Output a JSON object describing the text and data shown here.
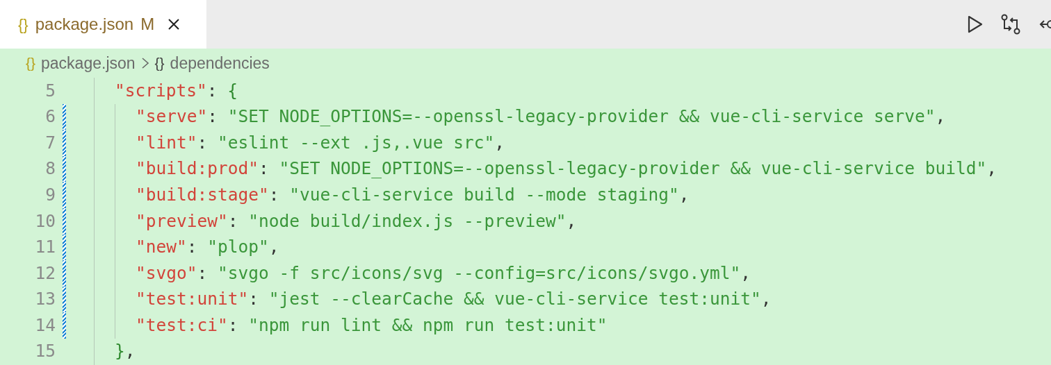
{
  "tab": {
    "icon": "{}",
    "title": "package.json",
    "badge": "M",
    "selected": true
  },
  "breadcrumbs": [
    {
      "icon": "{}",
      "label": "package.json",
      "kind": "file"
    },
    {
      "icon": "{}",
      "label": "dependencies",
      "kind": "symbol"
    }
  ],
  "lines": [
    {
      "number": "5",
      "modified": false,
      "tokens": [
        {
          "kind": "key",
          "text": "\"scripts\""
        },
        {
          "kind": "punct",
          "text": ": "
        },
        {
          "kind": "bracket",
          "text": "{"
        }
      ],
      "children": [
        {
          "number": "6",
          "modified": true,
          "tokens": [
            {
              "kind": "key",
              "text": "\"serve\""
            },
            {
              "kind": "punct",
              "text": ": "
            },
            {
              "kind": "string",
              "text": "\"SET NODE_OPTIONS=--openssl-legacy-provider && vue-cli-service serve\""
            },
            {
              "kind": "punct",
              "text": ","
            }
          ]
        },
        {
          "number": "7",
          "modified": true,
          "tokens": [
            {
              "kind": "key",
              "text": "\"lint\""
            },
            {
              "kind": "punct",
              "text": ": "
            },
            {
              "kind": "string",
              "text": "\"eslint --ext .js,.vue src\""
            },
            {
              "kind": "punct",
              "text": ","
            }
          ]
        },
        {
          "number": "8",
          "modified": true,
          "tokens": [
            {
              "kind": "key",
              "text": "\"build:prod\""
            },
            {
              "kind": "punct",
              "text": ": "
            },
            {
              "kind": "string",
              "text": "\"SET NODE_OPTIONS=--openssl-legacy-provider && vue-cli-service build\""
            },
            {
              "kind": "punct",
              "text": ","
            }
          ]
        },
        {
          "number": "9",
          "modified": true,
          "tokens": [
            {
              "kind": "key",
              "text": "\"build:stage\""
            },
            {
              "kind": "punct",
              "text": ": "
            },
            {
              "kind": "string",
              "text": "\"vue-cli-service build --mode staging\""
            },
            {
              "kind": "punct",
              "text": ","
            }
          ]
        },
        {
          "number": "10",
          "modified": true,
          "tokens": [
            {
              "kind": "key",
              "text": "\"preview\""
            },
            {
              "kind": "punct",
              "text": ": "
            },
            {
              "kind": "string",
              "text": "\"node build/index.js --preview\""
            },
            {
              "kind": "punct",
              "text": ","
            }
          ]
        },
        {
          "number": "11",
          "modified": true,
          "tokens": [
            {
              "kind": "key",
              "text": "\"new\""
            },
            {
              "kind": "punct",
              "text": ": "
            },
            {
              "kind": "string",
              "text": "\"plop\""
            },
            {
              "kind": "punct",
              "text": ","
            }
          ]
        },
        {
          "number": "12",
          "modified": true,
          "tokens": [
            {
              "kind": "key",
              "text": "\"svgo\""
            },
            {
              "kind": "punct",
              "text": ": "
            },
            {
              "kind": "string",
              "text": "\"svgo -f src/icons/svg --config=src/icons/svgo.yml\""
            },
            {
              "kind": "punct",
              "text": ","
            }
          ]
        },
        {
          "number": "13",
          "modified": true,
          "tokens": [
            {
              "kind": "key",
              "text": "\"test:unit\""
            },
            {
              "kind": "punct",
              "text": ": "
            },
            {
              "kind": "string",
              "text": "\"jest --clearCache && vue-cli-service test:unit\""
            },
            {
              "kind": "punct",
              "text": ","
            }
          ]
        },
        {
          "number": "14",
          "modified": true,
          "tokens": [
            {
              "kind": "key",
              "text": "\"test:ci\""
            },
            {
              "kind": "punct",
              "text": ": "
            },
            {
              "kind": "string",
              "text": "\"npm run lint && npm run test:unit\""
            }
          ]
        }
      ]
    },
    {
      "number": "15",
      "modified": false,
      "tokens": [
        {
          "kind": "bracket",
          "text": "}"
        },
        {
          "kind": "punct",
          "text": ","
        }
      ]
    }
  ]
}
